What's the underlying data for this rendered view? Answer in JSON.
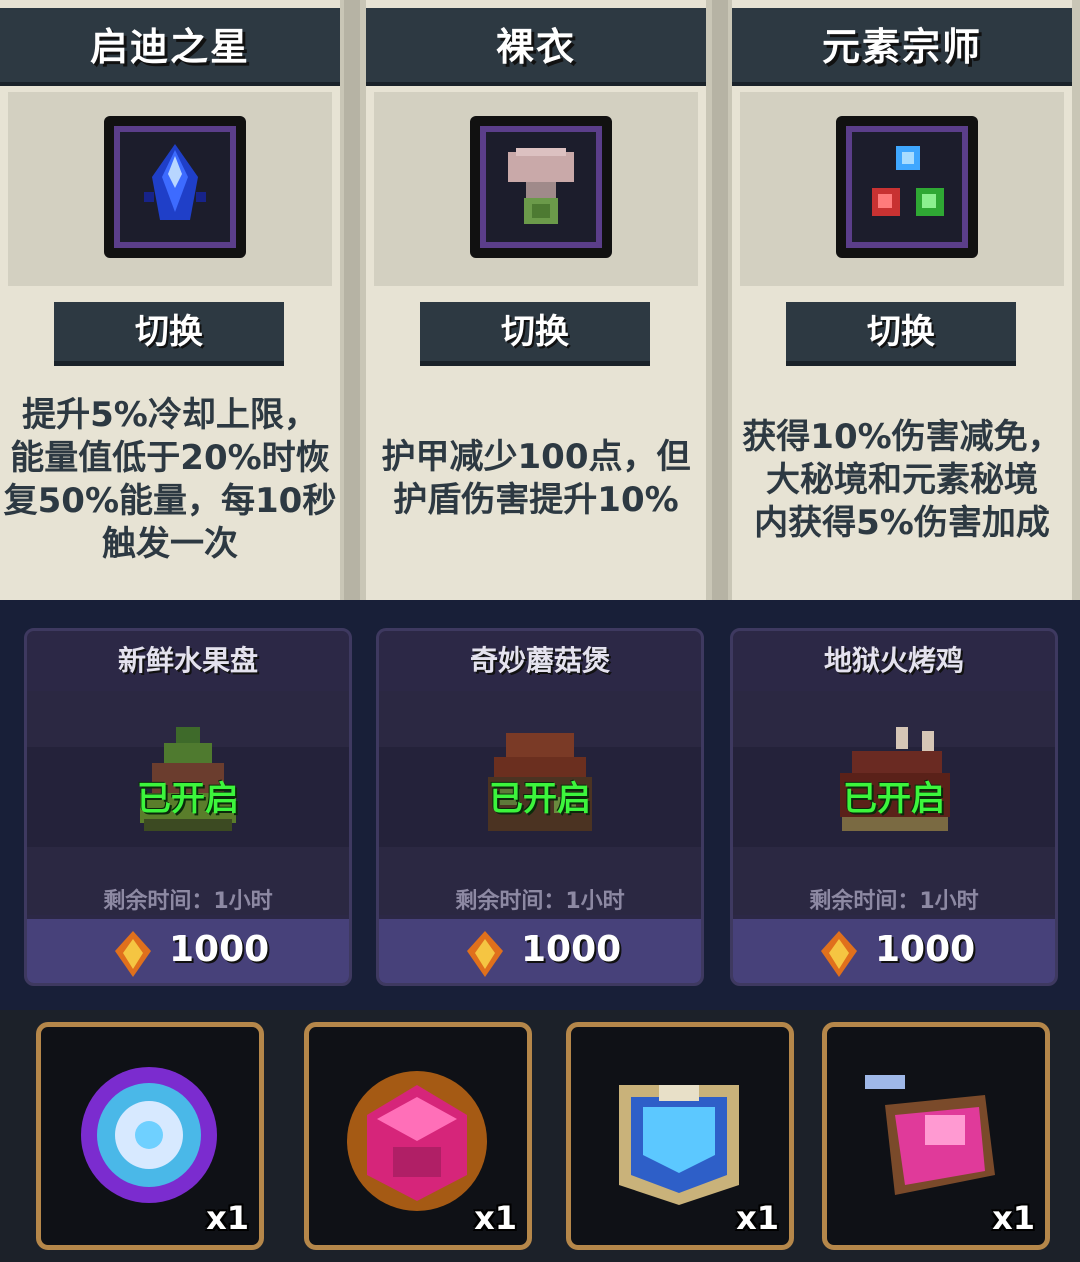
{
  "buffs": [
    {
      "title": "启迪之星",
      "button": "切换",
      "desc": [
        "提升5%冷却上限，",
        "能量值低于20%时恢",
        "复50%能量，每10秒",
        "触发一次"
      ]
    },
    {
      "title": "裸衣",
      "button": "切换",
      "desc": [
        "护甲减少100点，但",
        "护盾伤害提升10%"
      ]
    },
    {
      "title": "元素宗师",
      "button": "切换",
      "desc": [
        "获得10%伤害减免，",
        "大秘境和元素秘境",
        "内获得5%伤害加成"
      ]
    }
  ],
  "foods": [
    {
      "name": "新鲜水果盘",
      "status": "已开启",
      "remaining": "剩余时间：1小时",
      "cost": "1000"
    },
    {
      "name": "奇妙蘑菇煲",
      "status": "已开启",
      "remaining": "剩余时间：1小时",
      "cost": "1000"
    },
    {
      "name": "地狱火烤鸡",
      "status": "已开启",
      "remaining": "剩余时间：1小时",
      "cost": "1000"
    }
  ],
  "items": [
    {
      "icon": "purple-orb-icon",
      "qty": "x1"
    },
    {
      "icon": "pink-crystal-chest-icon",
      "qty": "x1"
    },
    {
      "icon": "blue-armor-icon",
      "qty": "x1"
    },
    {
      "icon": "pink-cannon-icon",
      "qty": "x1"
    }
  ],
  "colors": {
    "status_green": "#3cf53c",
    "slot_border": "#b5874a",
    "title_bar": "#2d3942"
  }
}
